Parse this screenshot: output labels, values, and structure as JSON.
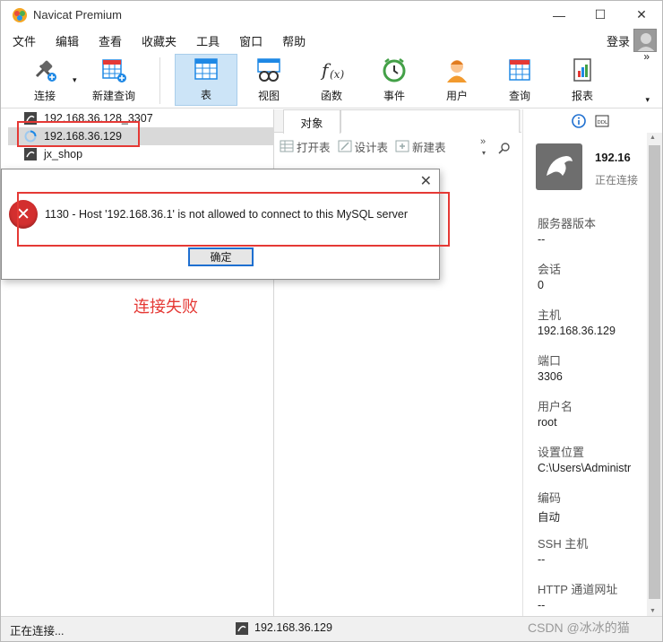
{
  "window": {
    "title": "Navicat Premium"
  },
  "menu": [
    "文件",
    "编辑",
    "查看",
    "收藏夹",
    "工具",
    "窗口",
    "帮助"
  ],
  "login_label": "登录",
  "toolbar": {
    "connect": "连接",
    "new_query": "新建查询",
    "table": "表",
    "view": "视图",
    "function": "函数",
    "event": "事件",
    "user": "用户",
    "query": "查询",
    "report": "报表"
  },
  "tree": [
    {
      "label": "192.168.36.128_3307"
    },
    {
      "label": "192.168.36.129"
    },
    {
      "label": "jx_shop"
    }
  ],
  "objects": {
    "tab": "对象",
    "open_table": "打开表",
    "design_table": "设计表",
    "new_table": "新建表"
  },
  "info": {
    "title": "192.16",
    "subtitle": "正在连接",
    "fields": [
      {
        "label": "服务器版本",
        "value": "--"
      },
      {
        "label": "会话",
        "value": "0"
      },
      {
        "label": "主机",
        "value": "192.168.36.129"
      },
      {
        "label": "端口",
        "value": "3306"
      },
      {
        "label": "用户名",
        "value": "root"
      },
      {
        "label": "设置位置",
        "value": "C:\\Users\\Administr"
      },
      {
        "label": "编码",
        "value": "自动"
      },
      {
        "label": "SSH 主机",
        "value": "--"
      },
      {
        "label": "HTTP 通道网址",
        "value": "--"
      }
    ]
  },
  "status": {
    "left": "正在连接...",
    "center": "192.168.36.129"
  },
  "dialog": {
    "message": "1130 - Host '192.168.36.1' is not allowed to connect to this MySQL server",
    "ok": "确定"
  },
  "annotation": "连接失败",
  "watermark": "CSDN @冰冰的猫"
}
